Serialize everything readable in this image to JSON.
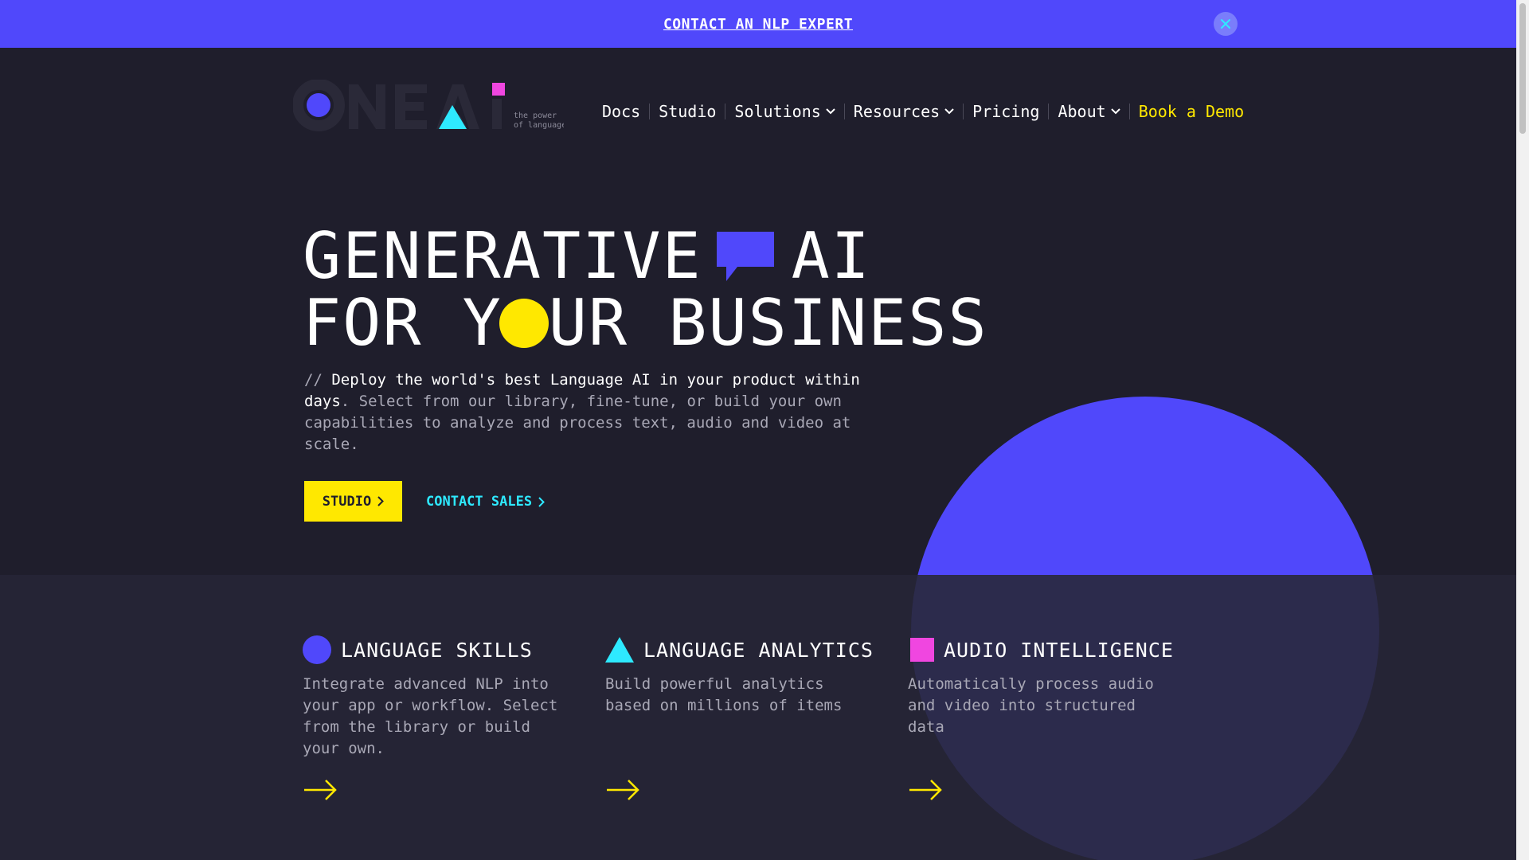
{
  "announcement": {
    "link_text": "CONTACT AN NLP EXPERT"
  },
  "logo": {
    "tagline_line1": "the power",
    "tagline_line2": "of language"
  },
  "nav": {
    "items": [
      {
        "label": "Docs"
      },
      {
        "label": "Studio"
      },
      {
        "label": "Solutions"
      },
      {
        "label": "Resources"
      },
      {
        "label": "Pricing"
      },
      {
        "label": "About"
      },
      {
        "label": "Book a Demo"
      }
    ]
  },
  "hero": {
    "line1_part1": "GENERATIVE",
    "line1_part2": "AI",
    "line2_part1": "FOR Y",
    "line2_part2": "UR BUSINESS",
    "desc_prefix": "// ",
    "desc_strong": "Deploy the world's best Language AI in your product within days",
    "desc_rest": ". Select from our library, fine-tune, or build your own capabilities to analyze and process text, audio and video at scale.",
    "primary_button": "STUDIO",
    "secondary_button": "CONTACT SALES"
  },
  "features": [
    {
      "title": "LANGUAGE SKILLS",
      "description": "Integrate advanced NLP into your app or workflow. Select from the library or build your own."
    },
    {
      "title": "LANGUAGE ANALYTICS",
      "description": "Build powerful analytics based on millions of items"
    },
    {
      "title": "AUDIO INTELLIGENCE",
      "description": "Automatically process audio and video into structured data"
    }
  ],
  "colors": {
    "background": "#1f1e2c",
    "band": "#252435",
    "brand_blue": "#5048fb",
    "yellow": "#ffe800",
    "cyan": "#2ee9ff",
    "magenta": "#f046e0"
  }
}
